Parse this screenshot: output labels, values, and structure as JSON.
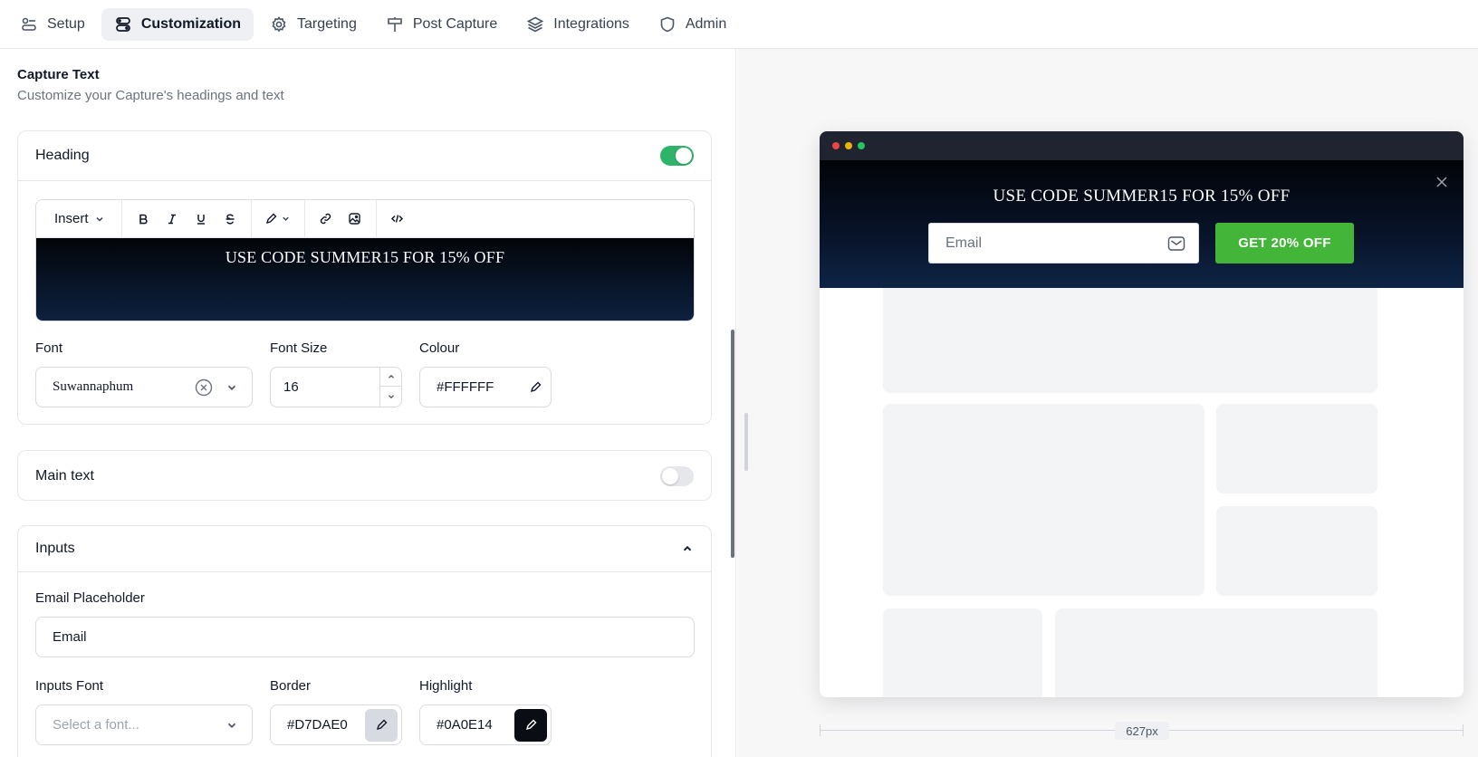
{
  "nav": {
    "tabs": [
      {
        "label": "Setup",
        "icon": "setup-icon"
      },
      {
        "label": "Customization",
        "icon": "customization-icon",
        "active": true
      },
      {
        "label": "Targeting",
        "icon": "gear-icon"
      },
      {
        "label": "Post Capture",
        "icon": "signpost-icon"
      },
      {
        "label": "Integrations",
        "icon": "layers-icon"
      },
      {
        "label": "Admin",
        "icon": "shield-icon"
      }
    ]
  },
  "section": {
    "title": "Capture Text",
    "subtitle": "Customize your Capture's headings and text"
  },
  "heading_card": {
    "label": "Heading",
    "enabled": true,
    "toolbar": {
      "insert_label": "Insert"
    },
    "editor_text": "USE CODE SUMMER15 FOR 15% OFF",
    "font_label": "Font",
    "font_value": "Suwannaphum",
    "size_label": "Font Size",
    "size_value": "16",
    "colour_label": "Colour",
    "colour_value": "#FFFFFF"
  },
  "main_text_card": {
    "label": "Main text",
    "enabled": false
  },
  "inputs_card": {
    "label": "Inputs",
    "email_placeholder_label": "Email Placeholder",
    "email_placeholder_value": "Email",
    "inputs_font_label": "Inputs Font",
    "inputs_font_placeholder": "Select a font...",
    "border_label": "Border",
    "border_value": "#D7DAE0",
    "highlight_label": "Highlight",
    "highlight_value": "#0A0E14"
  },
  "preview": {
    "banner_heading": "USE CODE SUMMER15 FOR 15% OFF",
    "email_placeholder": "Email",
    "cta_label": "GET 20% OFF",
    "width_label": "627px"
  },
  "colors": {
    "accent_green": "#2FB36A",
    "cta_green": "#43B63A",
    "banner_dark": "#0A0E14",
    "border": "#D7DAE0"
  }
}
